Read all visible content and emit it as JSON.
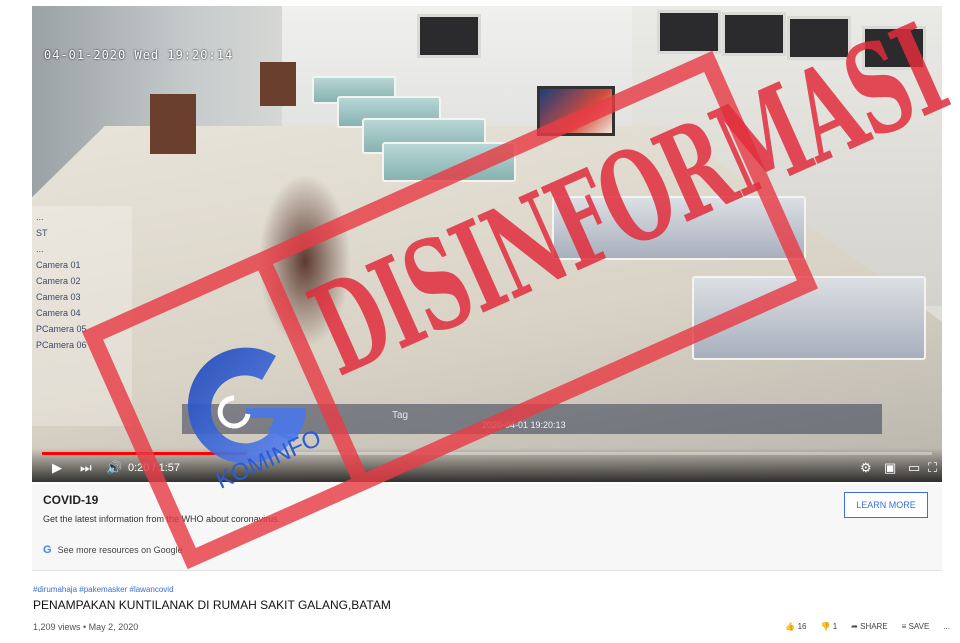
{
  "video": {
    "timestamp": "04-01-2020  Wed 19:20:14",
    "cctv_tag": "Tag",
    "cctv_time": "2020-04-01 19:20:13",
    "camera_list": [
      "...",
      "ST",
      "...",
      "Camera 01",
      "Camera 02",
      "Camera 03",
      "Camera 04",
      "PCamera 05",
      "PCamera 06"
    ],
    "player": {
      "current_time": "0:20 / 1:57",
      "progress": 0.23,
      "play_icon": "play-icon",
      "next_icon": "next-icon",
      "volume_icon": "volume-icon",
      "settings_icon": "gear-icon",
      "miniplayer_icon": "miniplayer-icon",
      "theater_icon": "theater-icon",
      "fullscreen_icon": "fullscreen-icon"
    }
  },
  "info_panel": {
    "title": "COVID-19",
    "description": "Get the latest information from the WHO about coronavirus.",
    "more_resources": "See more resources on Google",
    "google_glyph": "G",
    "learn_more_label": "LEARN MORE"
  },
  "below_video": {
    "hashtags": "#dirumahaja #pakemasker #lawancovid",
    "title": "PENAMPAKAN KUNTILANAK DI RUMAH SAKIT GALANG,BATAM",
    "meta": "1,209 views • May 2, 2020",
    "actions": [
      {
        "icon": "thumbs-up-icon",
        "label": "16"
      },
      {
        "icon": "thumbs-down-icon",
        "label": "1"
      },
      {
        "icon": "share-icon",
        "label": "SHARE"
      },
      {
        "icon": "save-icon",
        "label": "SAVE"
      },
      {
        "icon": "more-icon",
        "label": "..."
      }
    ]
  },
  "overlay": {
    "stamp_text": "DISINFORMASI",
    "logo_text": "KOMINFO",
    "stamp_color": "#e63c46",
    "logo_color": "#2c5bd6"
  }
}
